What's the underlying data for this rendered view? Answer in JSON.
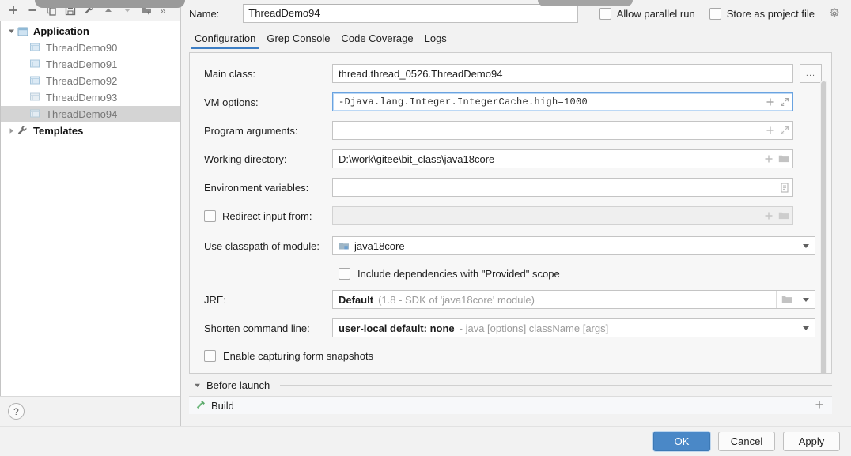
{
  "window": {
    "toolbar_icons": [
      "plus-icon",
      "minus-icon",
      "copy-icon",
      "save-icon",
      "wrench-icon",
      "arrow-up-icon",
      "arrow-down-icon",
      "folder-add-icon",
      "chevron-double-right-icon"
    ],
    "help_label": "?"
  },
  "tree": {
    "nodes": [
      {
        "label": "Application",
        "type": "group",
        "expanded": true,
        "icon": "application-icon"
      },
      {
        "label": "ThreadDemo90",
        "type": "child",
        "icon": "run-config-icon",
        "selected": false
      },
      {
        "label": "ThreadDemo91",
        "type": "child",
        "icon": "run-config-icon",
        "selected": false
      },
      {
        "label": "ThreadDemo92",
        "type": "child",
        "icon": "run-config-icon",
        "selected": false
      },
      {
        "label": "ThreadDemo93",
        "type": "child",
        "icon": "run-config-icon",
        "selected": false
      },
      {
        "label": "ThreadDemo94",
        "type": "child",
        "icon": "run-config-icon",
        "selected": true
      },
      {
        "label": "Templates",
        "type": "group",
        "expanded": false,
        "icon": "wrench-icon"
      }
    ]
  },
  "header": {
    "name_label": "Name:",
    "name_value": "ThreadDemo94",
    "allow_parallel_run": "Allow parallel run",
    "store_as_project_file": "Store as project file",
    "gear_icon": "gear-icon"
  },
  "tabs": [
    {
      "label": "Configuration",
      "active": true
    },
    {
      "label": "Grep Console",
      "active": false
    },
    {
      "label": "Code Coverage",
      "active": false
    },
    {
      "label": "Logs",
      "active": false
    }
  ],
  "form": {
    "main_class": {
      "label": "Main class:",
      "value": "thread.thread_0526.ThreadDemo94",
      "browse_label": "..."
    },
    "vm_options": {
      "label": "VM options:",
      "value": "-Djava.lang.Integer.IntegerCache.high=1000",
      "focused": true
    },
    "program_arguments": {
      "label": "Program arguments:",
      "value": ""
    },
    "working_directory": {
      "label": "Working directory:",
      "value": "D:\\work\\gitee\\bit_class\\java18core"
    },
    "environment_variables": {
      "label": "Environment variables:",
      "value": ""
    },
    "redirect_input": {
      "label": "Redirect input from:",
      "value": "",
      "checked": false
    },
    "classpath_module": {
      "label": "Use classpath of module:",
      "value": "java18core",
      "icon": "module-icon"
    },
    "include_provided": {
      "label": "Include dependencies with \"Provided\" scope",
      "checked": false
    },
    "jre": {
      "label": "JRE:",
      "value": "Default",
      "hint": "(1.8 - SDK of 'java18core' module)"
    },
    "shorten_command_line": {
      "label": "Shorten command line:",
      "value": "user-local default: none",
      "hint": "- java [options] className [args]"
    },
    "form_snapshots": {
      "label": "Enable capturing form snapshots",
      "checked": false
    }
  },
  "before_launch": {
    "title": "Before launch",
    "items": [
      {
        "label": "Build",
        "icon": "build-hammer-icon"
      }
    ],
    "add_icon": "plus-icon"
  },
  "footer": {
    "ok": "OK",
    "cancel": "Cancel",
    "apply": "Apply"
  },
  "colors": {
    "accent": "#4a88c7",
    "tab_underline": "#3d7ec4",
    "focus_border": "#6aa3e0",
    "selection": "#d4d4d4"
  }
}
